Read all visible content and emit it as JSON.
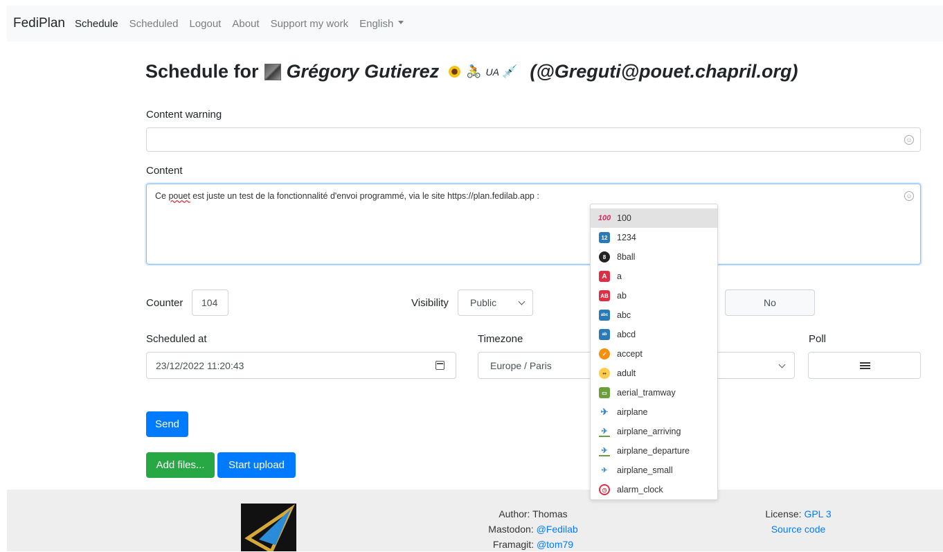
{
  "navbar": {
    "brand": "FediPlan",
    "items": [
      "Schedule",
      "Scheduled",
      "Logout",
      "About",
      "Support my work"
    ],
    "language": "English"
  },
  "heading": {
    "prefix": "Schedule for",
    "name": "Grégory Gutierez",
    "ua_text": "UA",
    "handle": "(@Greguti@pouet.chapril.org)"
  },
  "form": {
    "content_warning_label": "Content warning",
    "content_warning_value": "",
    "content_label": "Content",
    "content_value_before": "Ce ",
    "content_value_misspelled": "pouet",
    "content_value_after": " est juste un test de la fonctionnalité d'envoi programmé, via le site https://plan.fedilab.app :",
    "counter_label": "Counter",
    "counter_value": "104",
    "visibility_label": "Visibility",
    "visibility_value": "Public",
    "sensitive_value": "No",
    "scheduled_at_label": "Scheduled at",
    "scheduled_at_value": "23/12/2022 11:20:43",
    "timezone_label": "Timezone",
    "timezone_value": "Europe / Paris",
    "poll_label": "Poll"
  },
  "buttons": {
    "send": "Send",
    "add_files": "Add files...",
    "start_upload": "Start upload"
  },
  "emoji_suggestions": [
    {
      "name": "100",
      "icon": "hundred-points-icon",
      "color": "#e0245e"
    },
    {
      "name": "1234",
      "icon": "input-numbers-icon",
      "color": "#2a7ab8"
    },
    {
      "name": "8ball",
      "icon": "pool-8-ball-icon",
      "color": "#222222"
    },
    {
      "name": "a",
      "icon": "a-button-icon",
      "color": "#dd2e44"
    },
    {
      "name": "ab",
      "icon": "ab-button-icon",
      "color": "#dd2e44"
    },
    {
      "name": "abc",
      "icon": "input-latin-letters-icon",
      "color": "#2a7ab8"
    },
    {
      "name": "abcd",
      "icon": "input-latin-lowercase-icon",
      "color": "#2a7ab8"
    },
    {
      "name": "accept",
      "icon": "accept-icon",
      "color": "#f4900c"
    },
    {
      "name": "adult",
      "icon": "adult-face-icon",
      "color": "#ffcc4d"
    },
    {
      "name": "aerial_tramway",
      "icon": "aerial-tramway-icon",
      "color": "#6a9f3c"
    },
    {
      "name": "airplane",
      "icon": "airplane-icon",
      "color": "#3b88c3"
    },
    {
      "name": "airplane_arriving",
      "icon": "airplane-arriving-icon",
      "color": "#3b88c3"
    },
    {
      "name": "airplane_departure",
      "icon": "airplane-departure-icon",
      "color": "#3b88c3"
    },
    {
      "name": "airplane_small",
      "icon": "small-airplane-icon",
      "color": "#3b88c3"
    },
    {
      "name": "alarm_clock",
      "icon": "alarm-clock-icon",
      "color": "#dd2e44"
    }
  ],
  "footer": {
    "author": "Author: Thomas",
    "mastodon_label": "Mastodon:",
    "mastodon_link": "@Fedilab",
    "framagit_label": "Framagit:",
    "framagit_link": "@tom79",
    "license_label": "License:",
    "license_link": "GPL 3",
    "source_link": "Source code"
  }
}
